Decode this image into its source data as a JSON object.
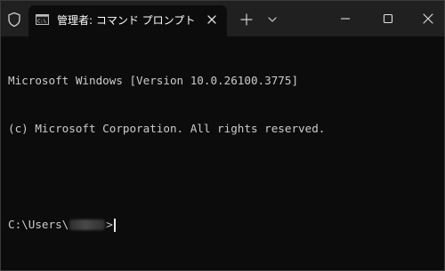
{
  "window": {
    "tab_title": "管理者: コマンド プロンプト",
    "tab_icon": "cmd-icon",
    "titlebar_icon": "shield-icon",
    "titlebar_buttons": [
      "new-tab-icon",
      "chevron-down-icon",
      "minimize-icon",
      "maximize-icon",
      "close-icon"
    ]
  },
  "console": {
    "line1": "Microsoft Windows [Version 10.0.26100.3775]",
    "line2": "(c) Microsoft Corporation. All rights reserved.",
    "prompt_prefix": "C:\\Users\\",
    "prompt_suffix": ">"
  },
  "colors": {
    "background": "#0c0c0c",
    "titlebar": "#202020",
    "text": "#cccccc"
  }
}
